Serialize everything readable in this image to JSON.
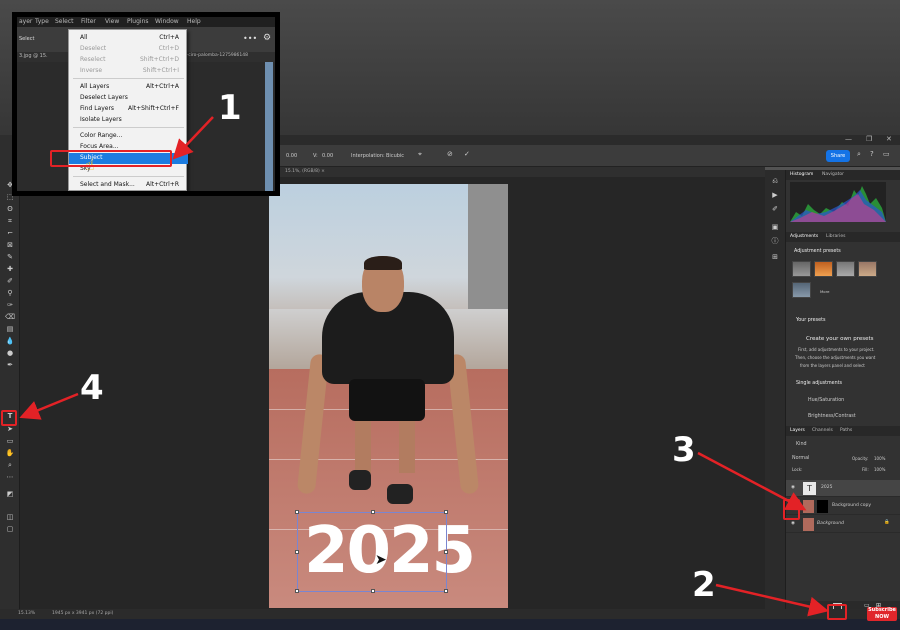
{
  "app": {
    "window_controls": {
      "min": "—",
      "max": "❐",
      "close": "✕"
    },
    "options_bar": {
      "x_value": "0.00",
      "v_value": "0.00",
      "v_label": "V:",
      "interpolation_label": "Interpolation:",
      "interpolation_value": "Bicubic",
      "share_label": "Share"
    },
    "doc_tab": "15.1%, (RGB/8) ×",
    "status": {
      "zoom": "15.13%",
      "size": "1945 px x 3941 px (72 ppi)"
    }
  },
  "inset": {
    "menubar": [
      "ayer",
      "Type",
      "Select",
      "Filter",
      "View",
      "Plugins",
      "Window",
      "Help"
    ],
    "toolbar_label": "Select",
    "tab_label": "3.jpg @ 15.",
    "tab_right": "exels-ciro-palomba-1275986148",
    "select_menu": [
      {
        "label": "All",
        "shortcut": "Ctrl+A",
        "state": "normal"
      },
      {
        "label": "Deselect",
        "shortcut": "Ctrl+D",
        "state": "disabled"
      },
      {
        "label": "Reselect",
        "shortcut": "Shift+Ctrl+D",
        "state": "disabled"
      },
      {
        "label": "Inverse",
        "shortcut": "Shift+Ctrl+I",
        "state": "disabled"
      },
      {
        "label": "All Layers",
        "shortcut": "Alt+Ctrl+A",
        "state": "normal"
      },
      {
        "label": "Deselect Layers",
        "shortcut": "",
        "state": "normal"
      },
      {
        "label": "Find Layers",
        "shortcut": "Alt+Shift+Ctrl+F",
        "state": "normal"
      },
      {
        "label": "Isolate Layers",
        "shortcut": "",
        "state": "normal"
      },
      {
        "label": "Color Range...",
        "shortcut": "",
        "state": "normal"
      },
      {
        "label": "Focus Area...",
        "shortcut": "",
        "state": "normal"
      },
      {
        "label": "Subject",
        "shortcut": "",
        "state": "highlighted"
      },
      {
        "label": "Sky",
        "shortcut": "",
        "state": "normal"
      },
      {
        "label": "Select and Mask...",
        "shortcut": "Alt+Ctrl+R",
        "state": "normal"
      }
    ]
  },
  "canvas": {
    "overlay_text": "2025"
  },
  "panels": {
    "histogram_tabs": [
      "Histogram",
      "Navigator"
    ],
    "adjustments_tabs": [
      "Adjustments",
      "Libraries"
    ],
    "adjustment_presets_label": "Adjustment presets",
    "more_label": "More",
    "your_presets_label": "Your presets",
    "create_presets_title": "Create your own presets",
    "create_presets_body": [
      "First, add adjustments to your project.",
      "Then, choose the adjustments you want",
      "from the layers panel and select"
    ],
    "single_adjustments_label": "Single adjustments",
    "single_items": [
      "Hue/Saturation",
      "Brightness/Contrast"
    ],
    "layers_tabs": [
      "Layers",
      "Channels",
      "Paths"
    ],
    "kind_label": "Kind",
    "blend_mode": "Normal",
    "opacity_label": "Opacity:",
    "opacity_value": "100%",
    "lock_label": "Lock:",
    "fill_label": "Fill:",
    "fill_value": "100%",
    "layers": [
      {
        "name": "2025",
        "type": "text"
      },
      {
        "name": "Background copy",
        "type": "masked"
      },
      {
        "name": "Background",
        "type": "image"
      }
    ]
  },
  "annotations": {
    "n1": "1",
    "n2": "2",
    "n3": "3",
    "n4": "4",
    "subscribe": "Subscribe",
    "subscribe2": "NOW"
  },
  "colors": {
    "highlight_red": "#e32226",
    "menu_highlight": "#1c7ce0",
    "share_blue": "#1473e6"
  }
}
